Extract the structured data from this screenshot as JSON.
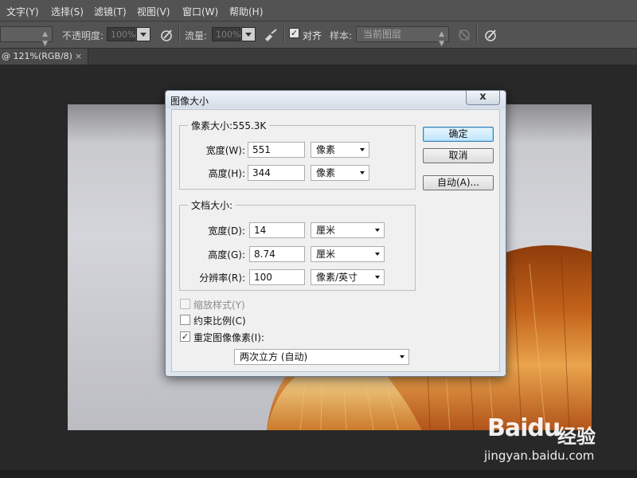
{
  "menu": [
    "文字(Y)",
    "选择(S)",
    "滤镜(T)",
    "视图(V)",
    "窗口(W)",
    "帮助(H)"
  ],
  "options_bar": {
    "opacity_label": "不透明度:",
    "opacity_value": "100%",
    "flow_label": "流量:",
    "flow_value": "100%",
    "align_label": "对齐",
    "align_checked": "✓",
    "sample_label": "样本:",
    "sample_value": "当前图层",
    "sample_arrow": "▲▼"
  },
  "doc_tab": {
    "title": "@ 121%(RGB/8)",
    "close": "×"
  },
  "dialog": {
    "title": "图像大小",
    "close": "x",
    "pixel_dims": {
      "legend": "像素大小:555.3K",
      "width_label": "宽度(W):",
      "width_value": "551",
      "width_unit": "像素",
      "height_label": "高度(H):",
      "height_value": "344",
      "height_unit": "像素"
    },
    "doc_size": {
      "legend": "文档大小:",
      "width_label": "宽度(D):",
      "width_value": "14",
      "width_unit": "厘米",
      "height_label": "高度(G):",
      "height_value": "8.74",
      "height_unit": "厘米",
      "res_label": "分辨率(R):",
      "res_value": "100",
      "res_unit": "像素/英寸"
    },
    "checkboxes": {
      "scale_styles": {
        "label": "缩放样式(Y)",
        "mark": ""
      },
      "constrain": {
        "label": "约束比例(C)",
        "mark": ""
      },
      "resample": {
        "label": "重定图像像素(I):",
        "mark": "✓"
      }
    },
    "resample_method": "两次立方 (自动)",
    "buttons": {
      "ok": "确定",
      "cancel": "取消",
      "auto": "自动(A)..."
    }
  },
  "watermark": {
    "logo": "Bai",
    "paw": "du",
    "brand": "经验",
    "url": "jingyan.baidu.com"
  },
  "colors": {
    "ui_dark": "#535353",
    "canvas_bg": "#282828",
    "dialog_frame": "#dfe6ee",
    "ok_button": "#bee6fd",
    "hair": "#c4661c"
  }
}
